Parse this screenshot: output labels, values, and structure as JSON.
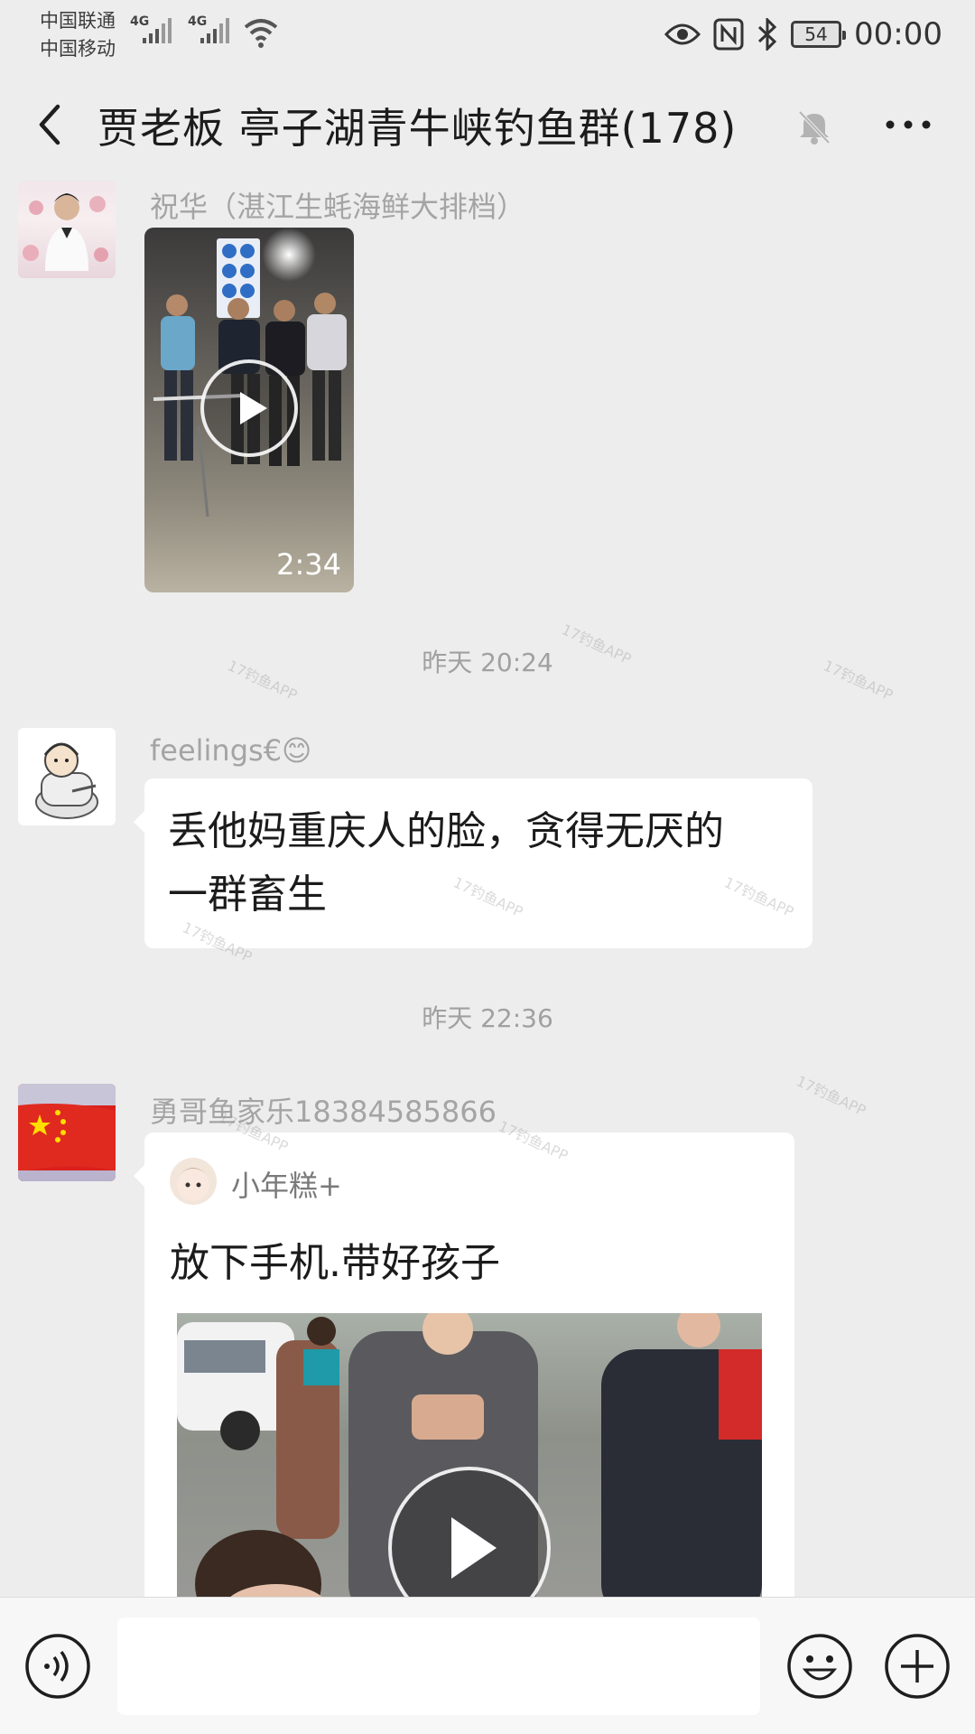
{
  "status_bar": {
    "carrier_1": "中国联通",
    "carrier_2": "中国移动",
    "network_1": "4G",
    "network_2": "4G",
    "battery": "54",
    "time": "00:00",
    "icons": [
      "eye-icon",
      "nfc-icon",
      "bluetooth-icon",
      "battery-icon",
      "wifi-icon",
      "signal-icon"
    ]
  },
  "header": {
    "title": "贾老板  亭子湖青牛峡钓鱼群(178)",
    "icons": [
      "back-icon",
      "mute-bell-icon",
      "more-icon"
    ]
  },
  "messages": [
    {
      "type": "video",
      "sender": "祝华（湛江生蚝海鲜大排档）",
      "duration": "2:34"
    },
    {
      "type": "time",
      "text": "昨天 20:24"
    },
    {
      "type": "text",
      "sender": "feelings€😊",
      "text_line1": "丢他妈重庆人的脸，贪得无厌的",
      "text_line2": "一群畜生"
    },
    {
      "type": "time",
      "text": "昨天 22:36"
    },
    {
      "type": "shared-video",
      "sender": "勇哥鱼家乐18384585866",
      "author": "小年糕+",
      "caption": "放下手机.带好孩子"
    }
  ],
  "watermark": "17钓鱼APP",
  "input_bar": {
    "placeholder": "",
    "icons": [
      "voice-icon",
      "emoji-icon",
      "plus-icon"
    ]
  },
  "colors": {
    "background": "#ededed",
    "bubble": "#ffffff",
    "meta_text": "#a4a4a4"
  }
}
